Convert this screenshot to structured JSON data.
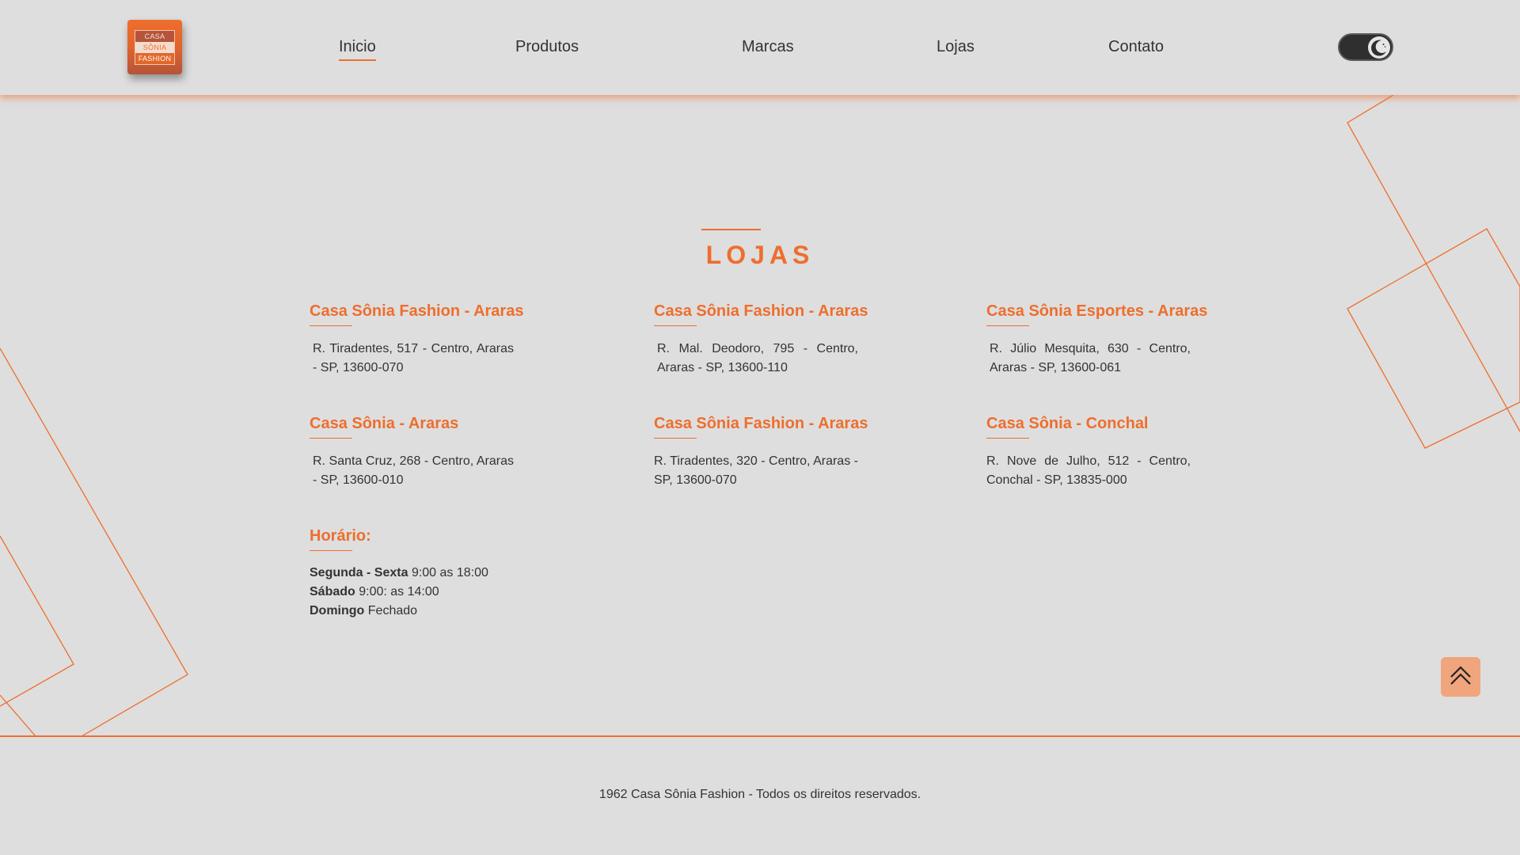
{
  "logo": {
    "line1": "CASA",
    "line2": "SÔNIA",
    "line3": "FASHION"
  },
  "nav": {
    "items": [
      {
        "label": "Inicio"
      },
      {
        "label": "Produtos"
      },
      {
        "label": "Marcas"
      },
      {
        "label": "Lojas"
      },
      {
        "label": "Contato"
      }
    ],
    "active": "Inicio"
  },
  "theme_toggle": {
    "icon": "moon-icon",
    "state": "dark"
  },
  "section": {
    "title": "LOJAS"
  },
  "stores": [
    {
      "name": "Casa Sônia Fashion - Araras",
      "address": "R. Tiradentes, 517 - Centro, Araras - SP, 13600-070"
    },
    {
      "name": "Casa Sônia Fashion - Araras",
      "address": "R. Mal. Deodoro, 795 - Centro, Araras - SP, 13600-110"
    },
    {
      "name": "Casa Sônia Esportes - Araras",
      "address": "R. Júlio Mesquita, 630 - Centro, Araras - SP, 13600-061"
    },
    {
      "name": "Casa Sônia - Araras",
      "address": "R. Santa Cruz, 268 - Centro, Araras - SP, 13600-010"
    },
    {
      "name": "Casa Sônia Fashion - Araras",
      "address": "R. Tiradentes, 320 - Centro, Araras - SP, 13600-070"
    },
    {
      "name": "Casa Sônia - Conchal",
      "address": "R. Nove de Julho, 512 - Centro, Conchal - SP, 13835-000"
    }
  ],
  "hours": {
    "title": "Horário:",
    "rows": [
      {
        "day": "Segunda - Sexta",
        "time": "9:00 as 18:00"
      },
      {
        "day": "Sábado",
        "time": "9:00: as 14:00"
      },
      {
        "day": "Domingo",
        "time": "Fechado"
      }
    ]
  },
  "back_to_top": {
    "icon": "double-chevron-up-icon"
  },
  "footer": {
    "text": "1962 Casa Sônia Fashion - Todos os direitos reservados."
  },
  "colors": {
    "accent": "#ee6e2d",
    "background": "#dedede",
    "text": "#333333",
    "button": "#f0a57c"
  }
}
